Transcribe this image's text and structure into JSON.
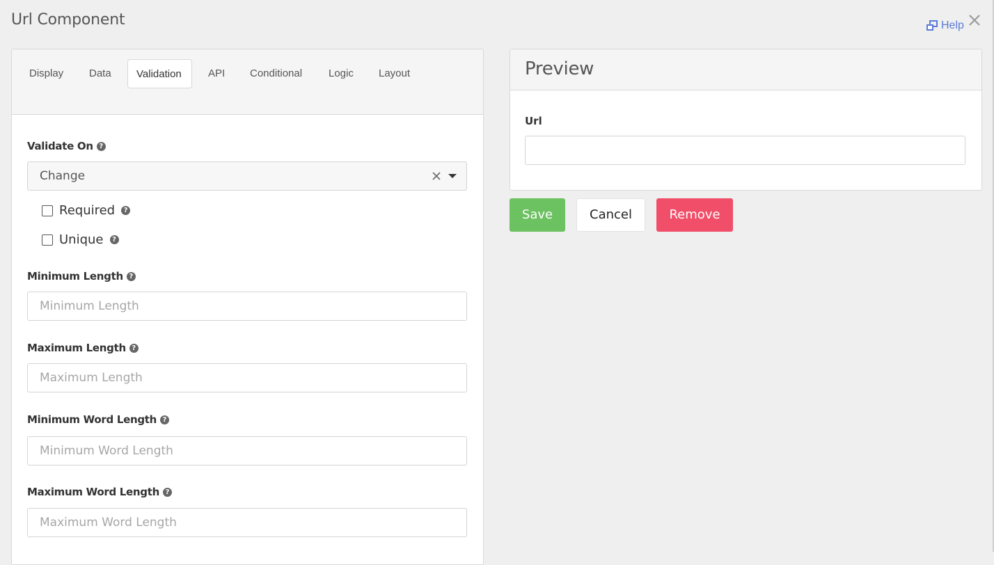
{
  "dialog": {
    "title": "Url Component",
    "help_label": "Help"
  },
  "tabs": [
    {
      "label": "Display"
    },
    {
      "label": "Data"
    },
    {
      "label": "Validation"
    },
    {
      "label": "API"
    },
    {
      "label": "Conditional"
    },
    {
      "label": "Logic"
    },
    {
      "label": "Layout"
    }
  ],
  "active_tab": "Validation",
  "validation": {
    "validate_on": {
      "label": "Validate On",
      "value": "Change"
    },
    "required": {
      "label": "Required",
      "checked": false
    },
    "unique": {
      "label": "Unique",
      "checked": false
    },
    "min_length": {
      "label": "Minimum Length",
      "placeholder": "Minimum Length"
    },
    "max_length": {
      "label": "Maximum Length",
      "placeholder": "Maximum Length"
    },
    "min_word_length": {
      "label": "Minimum Word Length",
      "placeholder": "Minimum Word Length"
    },
    "max_word_length": {
      "label": "Maximum Word Length",
      "placeholder": "Maximum Word Length"
    }
  },
  "preview": {
    "title": "Preview",
    "field_label": "Url",
    "field_value": ""
  },
  "actions": {
    "save": "Save",
    "cancel": "Cancel",
    "remove": "Remove"
  },
  "colors": {
    "save": "#6cc160",
    "remove": "#f14e69",
    "help_link": "#5b7bd5"
  },
  "icons": {
    "help": "external-window-icon",
    "close": "close-icon",
    "question": "question-circle-icon",
    "clear": "clear-x-icon",
    "caret": "caret-down-icon"
  }
}
